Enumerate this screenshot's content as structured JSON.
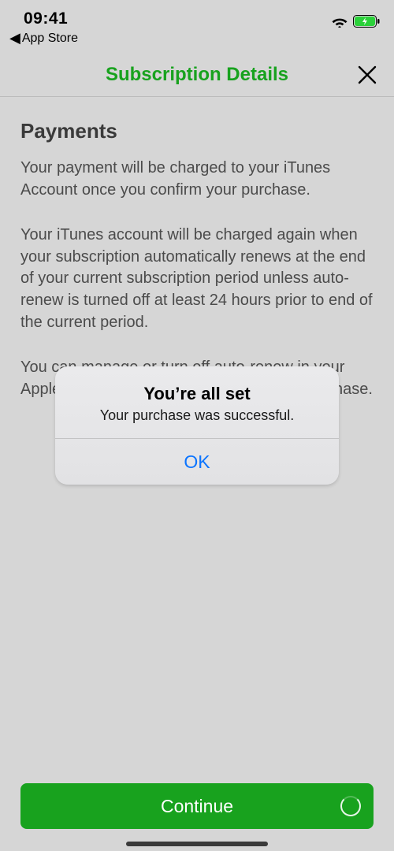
{
  "status": {
    "time": "09:41",
    "back_app_label": "App Store"
  },
  "nav": {
    "title": "Subscription Details"
  },
  "content": {
    "heading": "Payments",
    "p1": "Your payment will be charged to your iTunes Account once you confirm your purchase.",
    "p2": "Your iTunes account will be charged again when your subscription automatically renews at the end of your current subscription period unless auto-renew is turned off at least 24 hours prior to end of the current period.",
    "p3": "You can manage or turn off auto-renew in your Apple ID account settings any time after purchase."
  },
  "alert": {
    "title": "You’re all set",
    "message": "Your purchase was successful.",
    "ok_label": "OK"
  },
  "footer": {
    "continue_label": "Continue"
  },
  "colors": {
    "brand_green": "#18a21e",
    "ios_blue": "#0b74ff"
  }
}
